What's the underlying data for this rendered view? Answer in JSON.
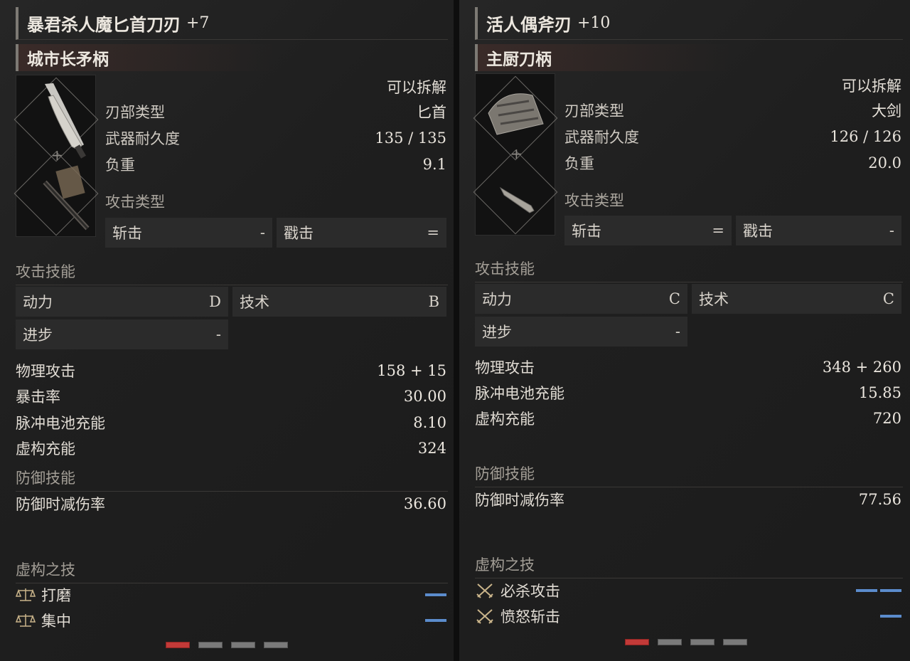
{
  "left": {
    "title": "暴君杀人魔匕首刀刃",
    "title_plus": "+7",
    "handle": "城市长矛柄",
    "dismantle": "可以拆解",
    "stats": [
      {
        "label": "刃部类型",
        "value": "匕首"
      },
      {
        "label": "武器耐久度",
        "value": "135 / 135"
      },
      {
        "label": "负重",
        "value": "9.1"
      }
    ],
    "attack_type_label": "攻击类型",
    "attack_types": [
      {
        "label": "斩击",
        "value": "-"
      },
      {
        "label": "戳击",
        "value": "="
      }
    ],
    "attack_skill_label": "攻击技能",
    "skills": [
      {
        "label": "动力",
        "value": "D"
      },
      {
        "label": "技术",
        "value": "B"
      },
      {
        "label": "进步",
        "value": "-"
      }
    ],
    "main_stats": [
      {
        "label": "物理攻击",
        "value": "158 + 15"
      },
      {
        "label": "暴击率",
        "value": "30.00"
      },
      {
        "label": "脉冲电池充能",
        "value": "8.10"
      },
      {
        "label": "虚构充能",
        "value": "324"
      }
    ],
    "defense_label": "防御技能",
    "defense_stats": [
      {
        "label": "防御时减伤率",
        "value": "36.60"
      }
    ],
    "fable_label": "虚构之技",
    "fable_skills": [
      {
        "name": "打磨",
        "icon": "scale-icon",
        "bars": 1
      },
      {
        "name": "集中",
        "icon": "scale-icon",
        "bars": 1
      }
    ],
    "pager": {
      "total": 4,
      "active": 0
    }
  },
  "right": {
    "title": "活人偶斧刃",
    "title_plus": "+10",
    "handle": "主厨刀柄",
    "dismantle": "可以拆解",
    "stats": [
      {
        "label": "刃部类型",
        "value": "大剑"
      },
      {
        "label": "武器耐久度",
        "value": "126 / 126"
      },
      {
        "label": "负重",
        "value": "20.0"
      }
    ],
    "attack_type_label": "攻击类型",
    "attack_types": [
      {
        "label": "斩击",
        "value": "="
      },
      {
        "label": "戳击",
        "value": "-"
      }
    ],
    "attack_skill_label": "攻击技能",
    "skills": [
      {
        "label": "动力",
        "value": "C"
      },
      {
        "label": "技术",
        "value": "C"
      },
      {
        "label": "进步",
        "value": "-"
      }
    ],
    "main_stats": [
      {
        "label": "物理攻击",
        "value": "348 + 260"
      },
      {
        "label": "脉冲电池充能",
        "value": "15.85"
      },
      {
        "label": "虚构充能",
        "value": "720"
      }
    ],
    "defense_label": "防御技能",
    "defense_stats": [
      {
        "label": "防御时减伤率",
        "value": "77.56"
      }
    ],
    "fable_label": "虚构之技",
    "fable_skills": [
      {
        "name": "必杀攻击",
        "icon": "crossed-swords-icon",
        "bars": 2
      },
      {
        "name": "愤怒斩击",
        "icon": "crossed-swords-icon",
        "bars": 1
      }
    ],
    "pager": {
      "total": 4,
      "active": 0
    }
  },
  "colors": {
    "accent_red": "#c23a38",
    "fable_bar_blue": "#5b8ccc"
  }
}
